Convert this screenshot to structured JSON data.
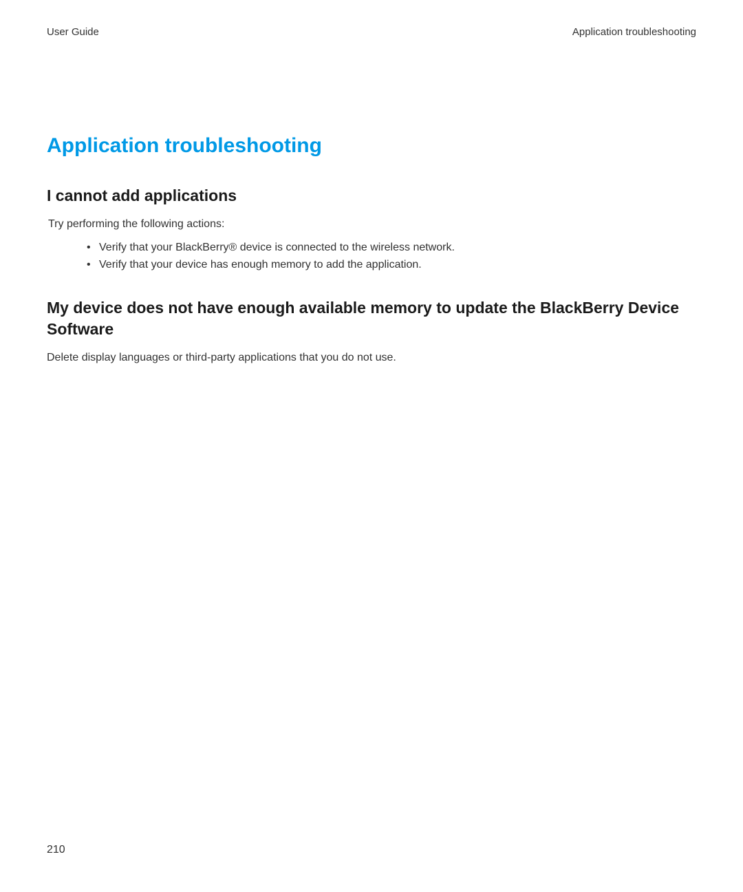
{
  "header": {
    "left": "User Guide",
    "right": "Application troubleshooting"
  },
  "page_title": "Application troubleshooting",
  "section1": {
    "heading": "I cannot add applications",
    "intro": "Try performing the following actions:",
    "bullets": [
      "Verify that your BlackBerry® device is connected to the wireless network.",
      "Verify that your device has enough memory to add the application."
    ]
  },
  "section2": {
    "heading": "My device does not have enough available memory to update the BlackBerry Device Software",
    "body": "Delete display languages or third-party applications that you do not use."
  },
  "page_number": "210"
}
